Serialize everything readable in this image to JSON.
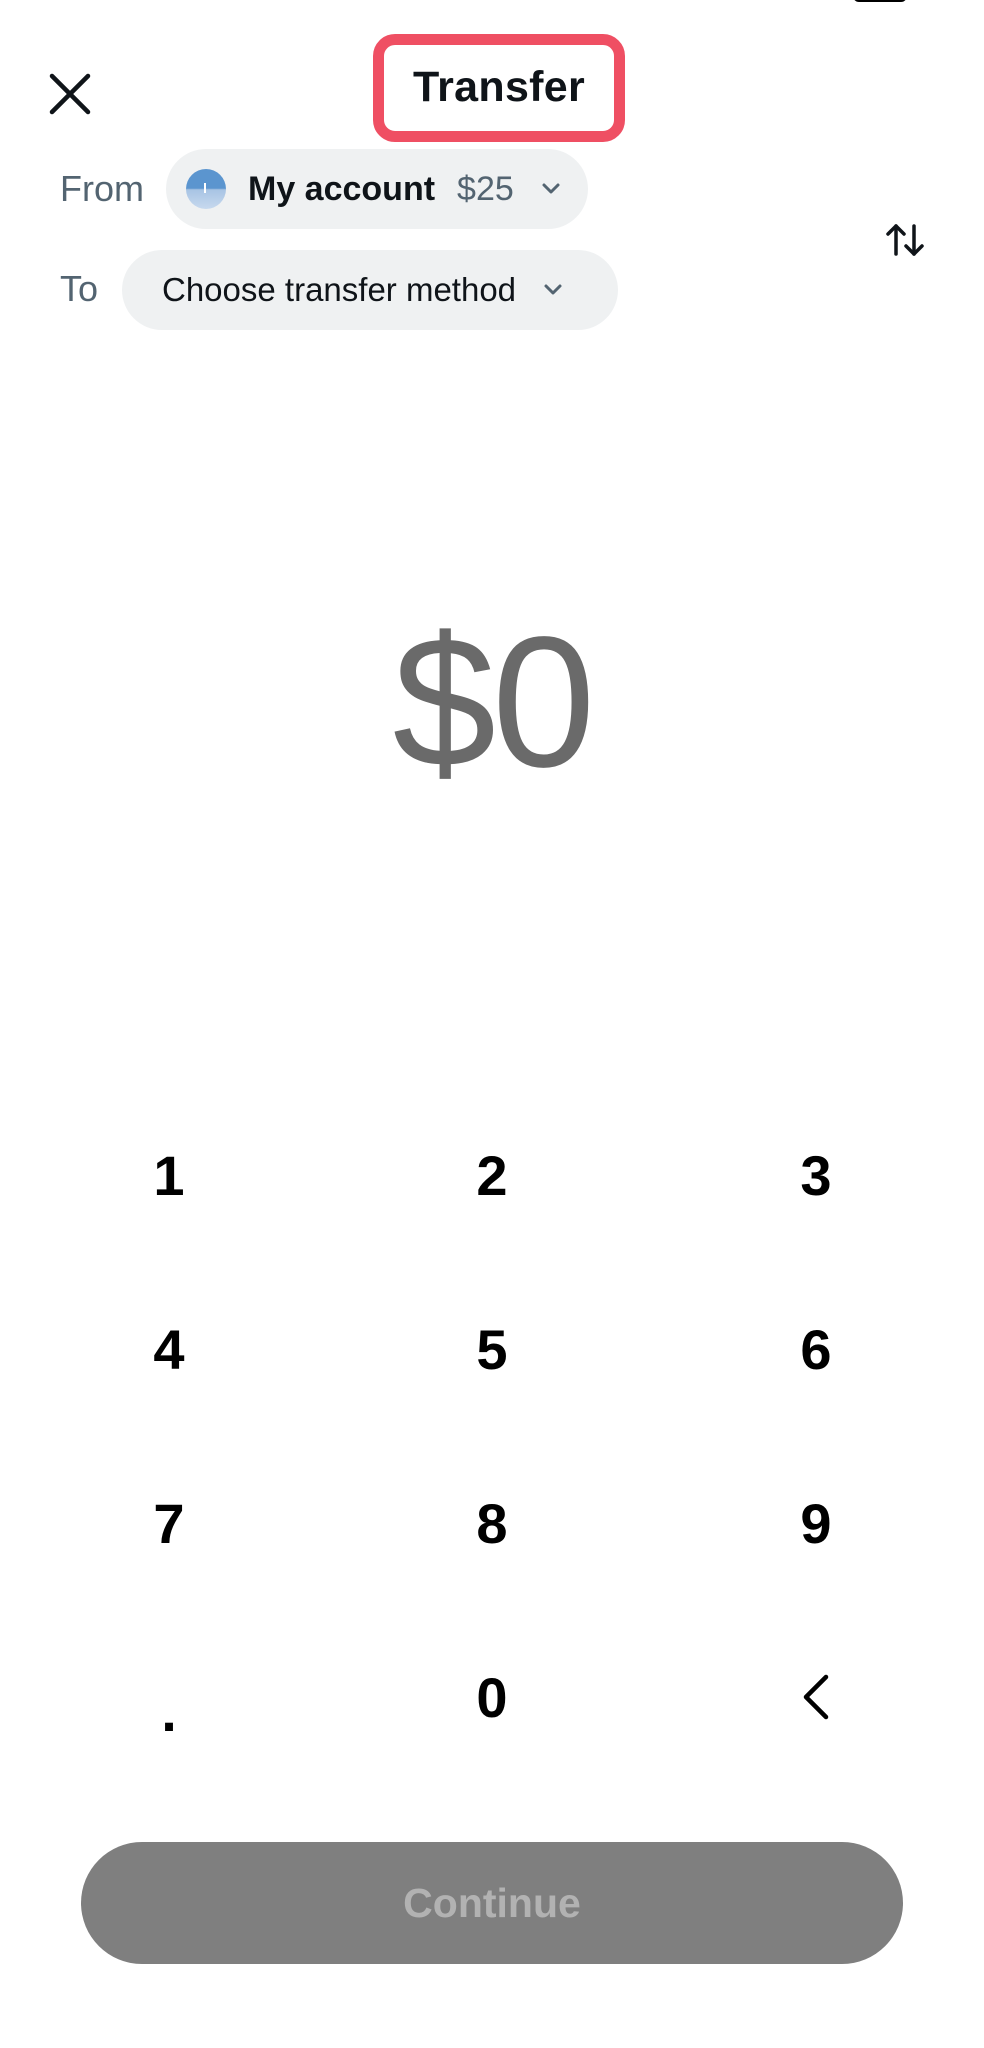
{
  "header": {
    "title": "Transfer",
    "highlight_color": "#ef4f63"
  },
  "from": {
    "label": "From",
    "account_name": "My account",
    "balance": "$25"
  },
  "to": {
    "label": "To",
    "placeholder": "Choose transfer method"
  },
  "amount": {
    "display": "$0"
  },
  "keypad": {
    "keys": [
      "1",
      "2",
      "3",
      "4",
      "5",
      "6",
      "7",
      "8",
      "9",
      ".",
      "0",
      "backspace"
    ]
  },
  "continue_button": {
    "label": "Continue",
    "enabled": false
  },
  "icons": {
    "close": "close-icon",
    "swap": "swap-arrows-icon",
    "chevron": "chevron-down-icon",
    "backspace": "backspace-chevron-icon"
  }
}
